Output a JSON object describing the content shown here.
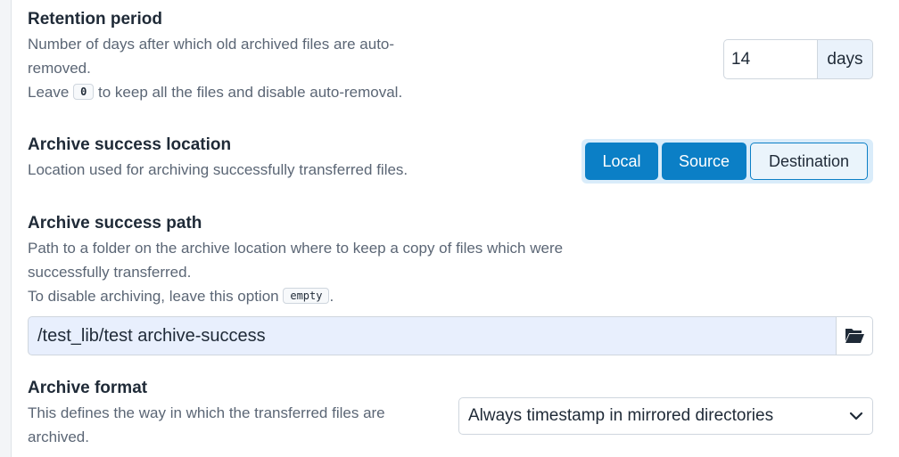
{
  "retention": {
    "title": "Retention period",
    "desc_line1": "Number of days after which old archived files are auto-",
    "desc_line2": "removed.",
    "desc_leave": "Leave",
    "zero_chip": "0",
    "desc_rest": "to keep all the files and disable auto-removal.",
    "value": "14",
    "unit": "days"
  },
  "location": {
    "title": "Archive success location",
    "desc": "Location used for archiving successfully transferred files.",
    "options": [
      "Local",
      "Source",
      "Destination"
    ],
    "selected": "Destination"
  },
  "path": {
    "title": "Archive success path",
    "desc_line1": "Path to a folder on the archive location where to keep a copy of files which were",
    "desc_line2": "successfully transferred.",
    "desc_disable": "To disable archiving, leave this option",
    "empty_chip": "empty",
    "period": ".",
    "value": "/test_lib/test archive-success",
    "browse_icon": "folder-open-icon"
  },
  "format": {
    "title": "Archive format",
    "desc_line1": "This defines the way in which the transferred files are",
    "desc_line2": "archived.",
    "selected": "Always timestamp in mirrored directories",
    "dropdown_icon": "chevron-down-icon"
  },
  "colors": {
    "accent": "#0b7fc6",
    "accent_light": "#d9ecfa",
    "input_fill": "#e8effd"
  }
}
